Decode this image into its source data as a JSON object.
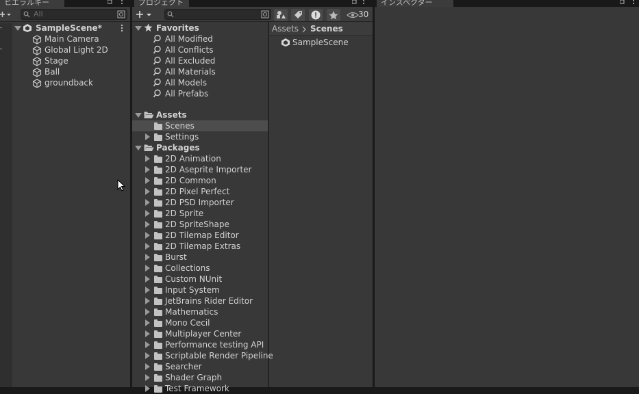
{
  "tabs": {
    "hierarchy": "ヒエラルキー",
    "project": "プロジェクト",
    "inspector": "インスペクター"
  },
  "hierarchy": {
    "search_placeholder": "All",
    "scene_name": "SampleScene*",
    "objects": [
      "Main Camera",
      "Global Light 2D",
      "Stage",
      "Ball",
      "groundback"
    ]
  },
  "project": {
    "hidden_count": "30",
    "favorites_label": "Favorites",
    "favorites": [
      "All Modified",
      "All Conflicts",
      "All Excluded",
      "All Materials",
      "All Models",
      "All Prefabs"
    ],
    "assets_label": "Assets",
    "assets_children": [
      "Scenes",
      "Settings"
    ],
    "packages_label": "Packages",
    "packages": [
      "2D Animation",
      "2D Aseprite Importer",
      "2D Common",
      "2D Pixel Perfect",
      "2D PSD Importer",
      "2D Sprite",
      "2D SpriteShape",
      "2D Tilemap Editor",
      "2D Tilemap Extras",
      "Burst",
      "Collections",
      "Custom NUnit",
      "Input System",
      "JetBrains Rider Editor",
      "Mathematics",
      "Mono Cecil",
      "Multiplayer Center",
      "Performance testing API",
      "Scriptable Render Pipeline",
      "Searcher",
      "Shader Graph",
      "Test Framework"
    ],
    "breadcrumb_root": "Assets",
    "breadcrumb_current": "Scenes",
    "contents": [
      "SampleScene"
    ]
  },
  "colors": {
    "panel": "#383838",
    "toolbar": "#3c3c3c",
    "selection": "#4d4d4d",
    "text": "#d2d2d2"
  }
}
